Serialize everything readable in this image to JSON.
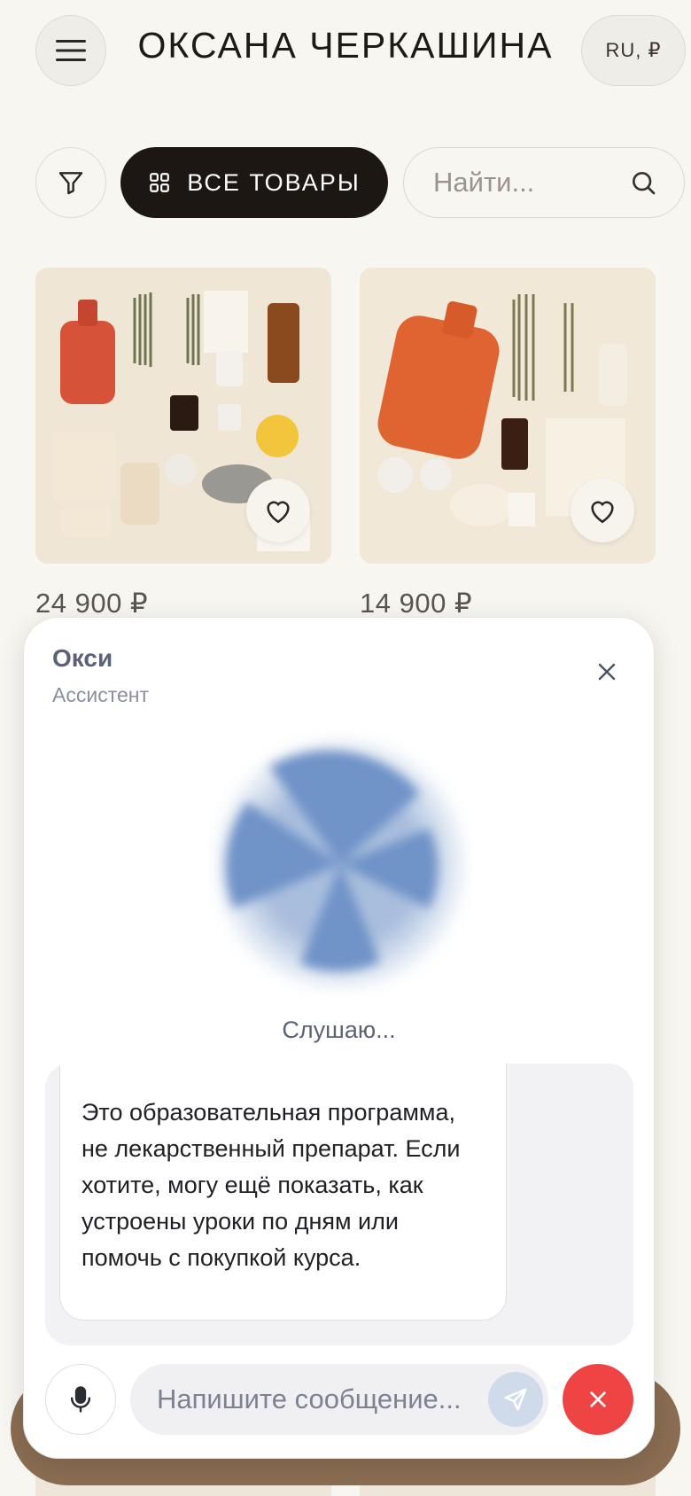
{
  "header": {
    "brand": "ОКСАНА ЧЕРКАШИНА",
    "locale": "RU, ₽",
    "menu_icon": "hamburger-icon"
  },
  "filters": {
    "all_label": "ВСЕ ТОВАРЫ",
    "search_placeholder": "Найти...",
    "filter_icon": "filter-icon",
    "grid_icon": "grid-icon",
    "search_icon": "search-icon"
  },
  "products": [
    {
      "price": "24 900 ₽",
      "image": "wellness-kit-flatlay",
      "favorite_icon": "heart-icon"
    },
    {
      "price": "14 900 ₽",
      "image": "hot-water-bottle-herbs-flatlay",
      "favorite_icon": "heart-icon"
    }
  ],
  "assistant": {
    "name": "Окси",
    "role": "Ассистент",
    "status": "Слушаю...",
    "message": "Это образовательная программа, не лекарственный препарат. Если хотите, могу ещё показать, как устроены уроки по дням или помочь с покупкой курса.",
    "input_placeholder": "Напишите сообщение...",
    "colors": {
      "orb": "#6f93c8",
      "end_call": "#ef4444",
      "send": "#cfdbea"
    }
  }
}
